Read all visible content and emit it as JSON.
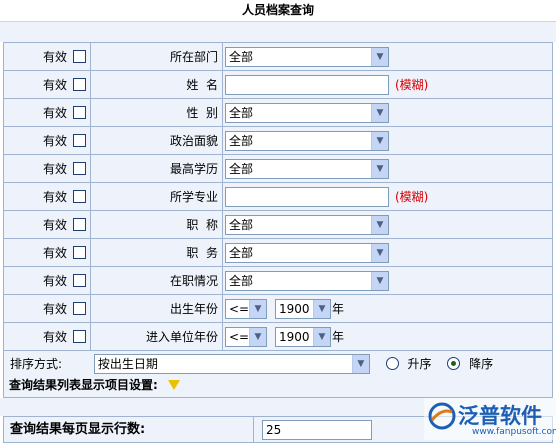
{
  "page": {
    "title": "人员档案查询"
  },
  "effective_label": "有效",
  "fuzzy_label": "(模糊)",
  "year_unit": "年",
  "fields": [
    {
      "label": "所在部门",
      "type": "select",
      "value": "全部"
    },
    {
      "label": "姓  名",
      "type": "text",
      "value": "",
      "fuzzy": true
    },
    {
      "label": "性  别",
      "type": "select",
      "value": "全部"
    },
    {
      "label": "政治面貌",
      "type": "select",
      "value": "全部"
    },
    {
      "label": "最高学历",
      "type": "select",
      "value": "全部"
    },
    {
      "label": "所学专业",
      "type": "text",
      "value": "",
      "fuzzy": true
    },
    {
      "label": "职  称",
      "type": "select",
      "value": "全部"
    },
    {
      "label": "职  务",
      "type": "select",
      "value": "全部"
    },
    {
      "label": "在职情况",
      "type": "select",
      "value": "全部"
    },
    {
      "label": "出生年份",
      "type": "year",
      "operator": "<=",
      "year": "1900"
    },
    {
      "label": "进入单位年份",
      "type": "year",
      "operator": "<=",
      "year": "1900"
    }
  ],
  "sort": {
    "label": "排序方式:",
    "value": "按出生日期",
    "asc_label": "升序",
    "desc_label": "降序",
    "selected": "desc"
  },
  "result_settings": {
    "label": "查询结果列表显示项目设置:"
  },
  "rows_per_page": {
    "label": "查询结果每页显示行数:",
    "value": "25"
  },
  "logo": {
    "brand": "泛普软件",
    "site": "www.fanpusoft.com",
    "color": "#1d5fb4"
  },
  "colors": {
    "row_bg": "#eef3fb",
    "border": "#9fb3d1",
    "fuzzy": "#d40000",
    "arrow_bg": "#c5d5f5"
  }
}
